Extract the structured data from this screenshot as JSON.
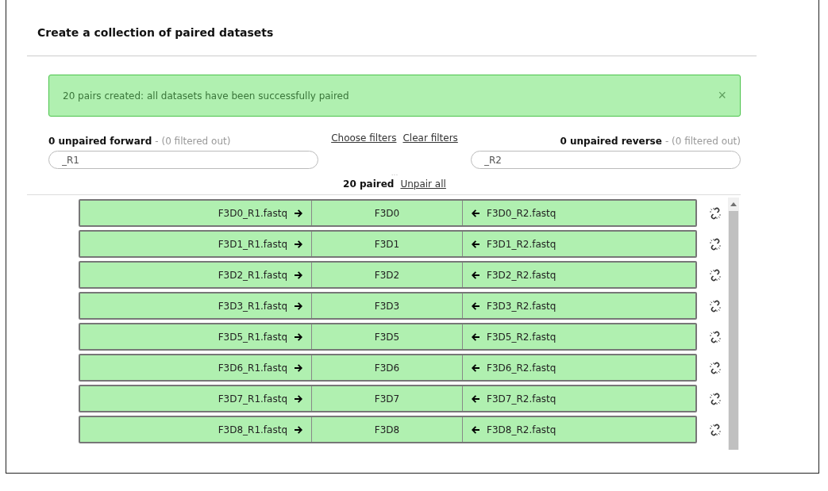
{
  "title": "Create a collection of paired datasets",
  "alert": {
    "message": "20 pairs created: all datasets have been successfully paired",
    "close": "×"
  },
  "forward": {
    "count": "0 unpaired forward",
    "filtered": "- (0 filtered out)",
    "filter": "_R1"
  },
  "filter_links": [
    "Choose filters",
    "Clear filters"
  ],
  "reverse": {
    "count": "0 unpaired reverse",
    "filtered": "- (0 filtered out)",
    "filter": "_R2"
  },
  "ellipsis": "...",
  "paired": {
    "count": "20 paired",
    "unpair_all": "Unpair all"
  },
  "pairs": [
    {
      "forward": "F3D0_R1.fastq",
      "name": "F3D0",
      "reverse": "F3D0_R2.fastq"
    },
    {
      "forward": "F3D1_R1.fastq",
      "name": "F3D1",
      "reverse": "F3D1_R2.fastq"
    },
    {
      "forward": "F3D2_R1.fastq",
      "name": "F3D2",
      "reverse": "F3D2_R2.fastq"
    },
    {
      "forward": "F3D3_R1.fastq",
      "name": "F3D3",
      "reverse": "F3D3_R2.fastq"
    },
    {
      "forward": "F3D5_R1.fastq",
      "name": "F3D5",
      "reverse": "F3D5_R2.fastq"
    },
    {
      "forward": "F3D6_R1.fastq",
      "name": "F3D6",
      "reverse": "F3D6_R2.fastq"
    },
    {
      "forward": "F3D7_R1.fastq",
      "name": "F3D7",
      "reverse": "F3D7_R2.fastq"
    },
    {
      "forward": "F3D8_R1.fastq",
      "name": "F3D8",
      "reverse": "F3D8_R2.fastq"
    }
  ]
}
